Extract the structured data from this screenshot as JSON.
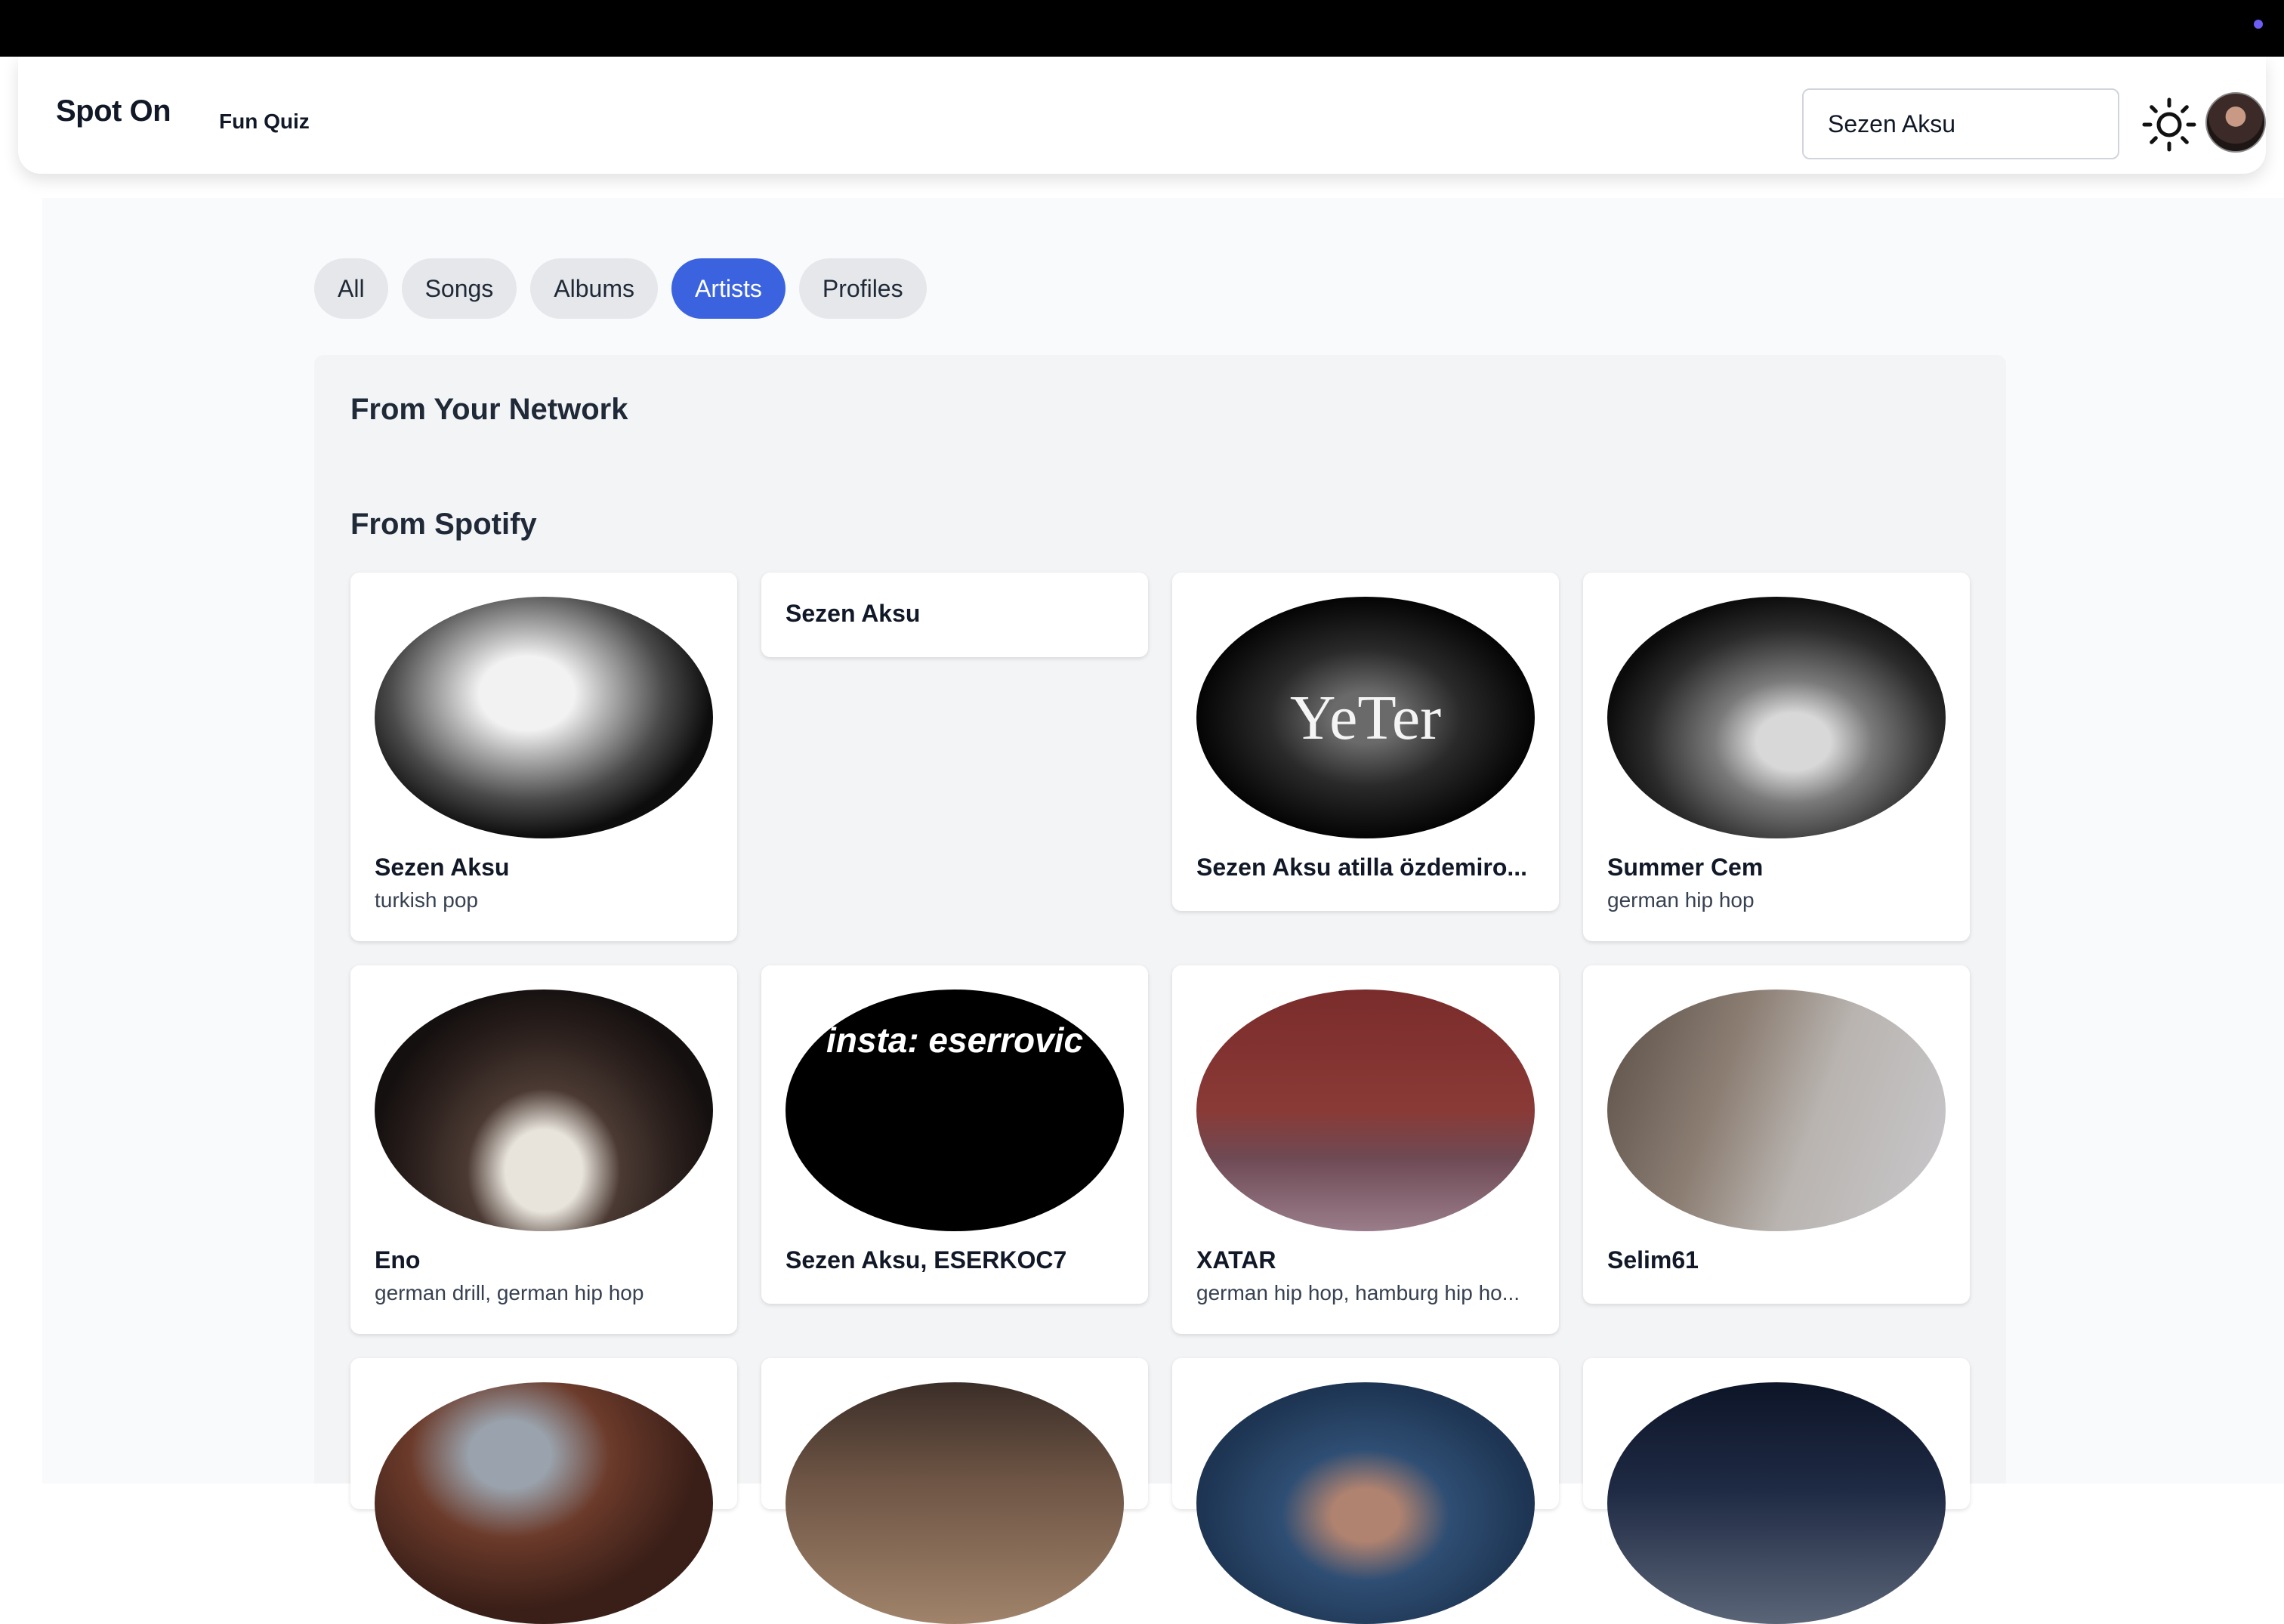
{
  "app": {
    "brand": "Spot On",
    "nav": {
      "fun_quiz": "Fun Quiz"
    },
    "search": {
      "value": "Sezen Aksu",
      "placeholder": "Search"
    },
    "theme_icon": "sun-icon",
    "avatar_icon": "user-avatar"
  },
  "filters": {
    "tabs": [
      "All",
      "Songs",
      "Albums",
      "Artists",
      "Profiles"
    ],
    "active": "Artists"
  },
  "sections": {
    "network_title": "From Your Network",
    "spotify_title": "From Spotify"
  },
  "artists": [
    {
      "name": "Sezen Aksu",
      "genre": "turkish pop"
    },
    {
      "name": "Sezen Aksu",
      "genre": ""
    },
    {
      "name": "Sezen Aksu atilla özdemiro...",
      "genre": "",
      "image_text": "YeTer"
    },
    {
      "name": "Summer Cem",
      "genre": "german hip hop"
    },
    {
      "name": "Eno",
      "genre": "german drill, german hip hop"
    },
    {
      "name": "Sezen Aksu, ESERKOC7",
      "genre": "",
      "image_text": "insta: eserrovic"
    },
    {
      "name": "XATAR",
      "genre": "german hip hop, hamburg hip ho..."
    },
    {
      "name": "Selim61",
      "genre": ""
    }
  ],
  "colors": {
    "accent": "#3b63e0",
    "panel": "#f3f4f6",
    "tab": "#e5e7eb"
  }
}
